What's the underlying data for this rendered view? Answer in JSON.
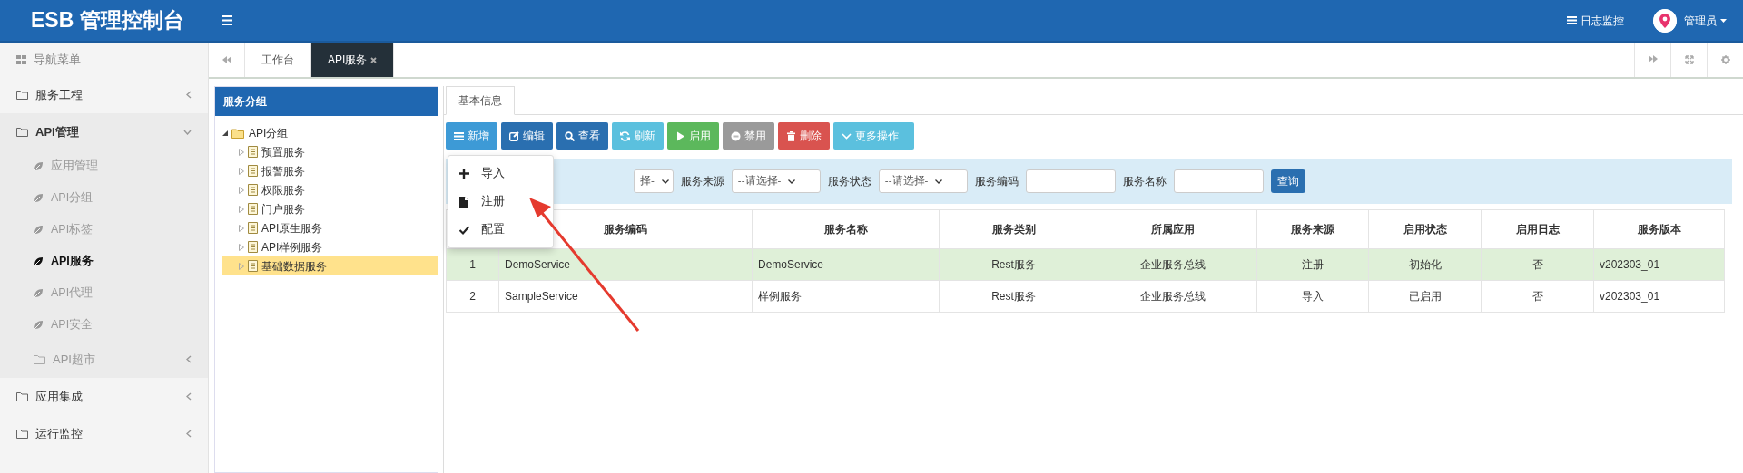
{
  "header": {
    "logo": "ESB 管理控制台",
    "log_monitor": "日志监控",
    "user": "管理员"
  },
  "sidebar": {
    "title": "导航菜单",
    "items": [
      {
        "kind": "group",
        "label": "服务工程",
        "expanded": false
      },
      {
        "kind": "group",
        "label": "API管理",
        "expanded": true,
        "children": [
          {
            "kind": "link",
            "label": "应用管理",
            "selected": false
          },
          {
            "kind": "link",
            "label": "API分组",
            "selected": false
          },
          {
            "kind": "link",
            "label": "API标签",
            "selected": false
          },
          {
            "kind": "link",
            "label": "API服务",
            "selected": true
          },
          {
            "kind": "link",
            "label": "API代理",
            "selected": false
          },
          {
            "kind": "link",
            "label": "API安全",
            "selected": false
          },
          {
            "kind": "group",
            "label": "API超市",
            "expanded": false
          }
        ]
      },
      {
        "kind": "group",
        "label": "应用集成",
        "expanded": false
      },
      {
        "kind": "group",
        "label": "运行监控",
        "expanded": false
      }
    ]
  },
  "tabs": [
    {
      "label": "工作台",
      "selected": false,
      "closable": false
    },
    {
      "label": "API服务",
      "selected": true,
      "closable": true
    }
  ],
  "tree": {
    "title": "服务分组",
    "root": {
      "label": "API分组",
      "expanded": true,
      "children": [
        {
          "label": "预置服务",
          "expanded": false,
          "selected": false
        },
        {
          "label": "报警服务",
          "expanded": false,
          "selected": false
        },
        {
          "label": "权限服务",
          "expanded": false,
          "selected": false
        },
        {
          "label": "门户服务",
          "expanded": false,
          "selected": false
        },
        {
          "label": "API原生服务",
          "expanded": false,
          "selected": false
        },
        {
          "label": "API样例服务",
          "expanded": false,
          "selected": false
        },
        {
          "label": "基础数据服务",
          "expanded": false,
          "selected": true
        }
      ]
    }
  },
  "content_tabs": [
    {
      "label": "基本信息",
      "selected": true
    }
  ],
  "toolbar": [
    {
      "kind": "add",
      "label": "新增",
      "disabled": false
    },
    {
      "kind": "edit",
      "label": "编辑",
      "disabled": false
    },
    {
      "kind": "view",
      "label": "查看",
      "disabled": false
    },
    {
      "kind": "refresh",
      "label": "刷新",
      "disabled": false
    },
    {
      "kind": "enable",
      "label": "启用",
      "disabled": false
    },
    {
      "kind": "disable",
      "label": "禁用",
      "disabled": true
    },
    {
      "kind": "delete",
      "label": "删除",
      "disabled": false
    },
    {
      "kind": "more",
      "label": "更多操作",
      "disabled": false
    }
  ],
  "dropdown": {
    "items": [
      {
        "kind": "import",
        "label": "导入"
      },
      {
        "kind": "register",
        "label": "注册"
      },
      {
        "kind": "config",
        "label": "配置"
      }
    ]
  },
  "filters": [
    {
      "kind": "select",
      "value": "择-"
    },
    {
      "kind": "label",
      "text": "服务来源"
    },
    {
      "kind": "select",
      "value": "--请选择-"
    },
    {
      "kind": "label",
      "text": "服务状态"
    },
    {
      "kind": "select",
      "value": "--请选择-"
    },
    {
      "kind": "label",
      "text": "服务编码"
    },
    {
      "kind": "input"
    },
    {
      "kind": "label",
      "text": "服务名称"
    },
    {
      "kind": "input"
    }
  ],
  "search_button": "查询",
  "table": {
    "columns": [
      "",
      "服务编码",
      "服务名称",
      "服务类别",
      "所属应用",
      "服务来源",
      "启用状态",
      "启用日志",
      "服务版本"
    ],
    "rows": [
      {
        "selected": true,
        "cells": [
          "1",
          "DemoService",
          "DemoService",
          "Rest服务",
          "企业服务总线",
          "注册",
          "初始化",
          "否",
          "v202303_01"
        ]
      },
      {
        "selected": false,
        "cells": [
          "2",
          "SampleService",
          "样例服务",
          "Rest服务",
          "企业服务总线",
          "导入",
          "已启用",
          "否",
          "v202303_01"
        ]
      }
    ]
  }
}
